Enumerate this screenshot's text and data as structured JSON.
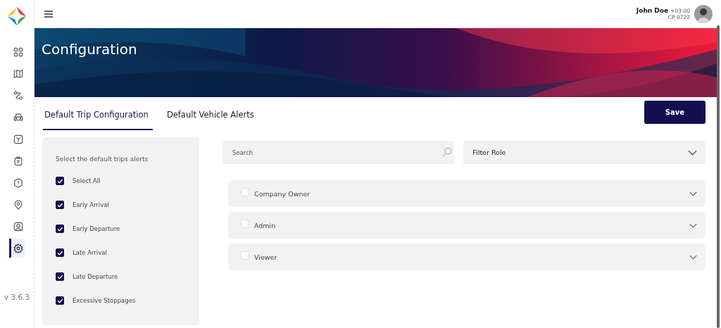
{
  "sidebar": {
    "items": [
      {
        "kind": "grid",
        "selected": false
      },
      {
        "kind": "map",
        "selected": false
      },
      {
        "kind": "route",
        "selected": false
      },
      {
        "kind": "car",
        "selected": false
      },
      {
        "kind": "box",
        "selected": false
      },
      {
        "kind": "clipboard",
        "selected": false
      },
      {
        "kind": "alert",
        "selected": false
      },
      {
        "kind": "pin",
        "selected": false
      },
      {
        "kind": "user",
        "selected": false
      },
      {
        "kind": "gear",
        "selected": true
      }
    ],
    "version": "v 3.6.3"
  },
  "header": {
    "user_name": "John Doe",
    "timezone": "+03:00",
    "user_code": "CP 0722"
  },
  "banner": {
    "kind": "picture",
    "title": "Configuration"
  },
  "tabs": [
    {
      "label": "Default Trip Configuration",
      "selected": true
    },
    {
      "label": "Default Vehicle Alerts",
      "selected": false
    }
  ],
  "save_button": "Save",
  "alerts_panel": {
    "heading": "Select the default trips alerts",
    "items": [
      {
        "label": "Select All",
        "checked": true
      },
      {
        "label": "Early Arrival",
        "checked": true
      },
      {
        "label": "Early Departure",
        "checked": true
      },
      {
        "label": "Late Arrival",
        "checked": true
      },
      {
        "label": "Late Departure",
        "checked": true
      },
      {
        "label": "Excessive Stoppages",
        "checked": true
      }
    ]
  },
  "search": {
    "placeholder": "Search"
  },
  "filter": {
    "value": "Filter Role"
  },
  "roles": [
    {
      "label": "Company Owner",
      "checked": false
    },
    {
      "label": "Admin",
      "checked": false
    },
    {
      "label": "Viewer",
      "checked": false
    }
  ]
}
